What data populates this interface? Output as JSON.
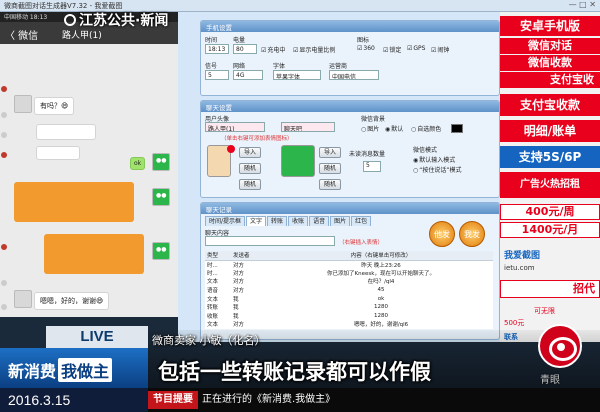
{
  "window": {
    "title": "微商截图对话生成器V7.32 - 我爱截图",
    "controls": "— □ ✕"
  },
  "phone": {
    "status": "中国移动  18:13",
    "back": "〈 微信",
    "contact": "路人甲(1)",
    "messages": [
      {
        "side": "left",
        "text": "有吗？😄"
      },
      {
        "side": "right",
        "text": "ok"
      },
      {
        "side": "left",
        "text": "嗯嗯，好的，谢谢😄"
      }
    ]
  },
  "settings_panel": {
    "title": "手机设置",
    "time_label": "时间",
    "time_value": "18:13",
    "battery_label": "电量",
    "battery_value": "80",
    "charging_label": "充电中",
    "show_percent_label": "显示电量比例",
    "icon_label": "图标",
    "icon_options": [
      {
        "label": "360",
        "on": true
      },
      {
        "label": "锁定",
        "on": true
      },
      {
        "label": "GPS",
        "on": true
      },
      {
        "label": "闹钟",
        "on": true
      }
    ],
    "signal_label": "信号",
    "signal_value": "5",
    "network_label": "网络",
    "network_value": "4G",
    "font_label": "字体",
    "font_value": "苹果字体",
    "carrier_label": "运营商",
    "carrier_value": "中国电信"
  },
  "chat_panel": {
    "title": "聊天设置",
    "user_avatar_label": "用户头像",
    "nickname_a": "路人甲(1)",
    "nickname_b": "聊天吧",
    "avatar_hint": "（单击右键可添加表情图标）",
    "import_label": "导入",
    "random_label": "随机",
    "bg_label": "微信背景",
    "bg_options": [
      {
        "label": "图片",
        "on": false
      },
      {
        "label": "默认",
        "on": true
      },
      {
        "label": "自选颜色",
        "on": false
      }
    ],
    "unread_label": "未读消息数量",
    "unread_value": "5",
    "mode_label": "微信模式",
    "mode_options": [
      {
        "label": "默认输入模式",
        "on": true
      },
      {
        "label": "“按住说话”模式",
        "on": false
      }
    ]
  },
  "message_panel": {
    "title": "聊天记录",
    "tabs": [
      "时间/提示框",
      "文字",
      "转账",
      "收账",
      "语音",
      "图片",
      "红包"
    ],
    "active_tab": 1,
    "chat_with_label": "聊天内容",
    "hint": "（右键插入表情）",
    "send_label": "他发",
    "send_label_b": "我发",
    "columns": [
      "类型",
      "发送者",
      "内容（右键单击可修改）"
    ],
    "rows": [
      [
        "时...",
        "对方",
        "昨天 晚上23:26"
      ],
      [
        "时...",
        "对方",
        "你已添加了Kneesk，现在可以开始聊天了。"
      ],
      [
        "文本",
        "对方",
        "在吗？/ql4"
      ],
      [
        "语音",
        "对方",
        "45"
      ],
      [
        "文本",
        "我",
        "ok"
      ],
      [
        "转账",
        "我",
        "1280"
      ],
      [
        "收账",
        "我",
        "1280"
      ],
      [
        "文本",
        "对方",
        "嗯嗯，好的，谢谢/ql6"
      ]
    ]
  },
  "ads": {
    "a1": "安卓手机版",
    "a2": "微信对话",
    "a3": "微信收款",
    "a4": "支付宝收",
    "a5": "支付宝收款",
    "a6": "明细/账单",
    "a7": "支持5S/6P",
    "a8": "广告火热招租",
    "a9": "400元/周",
    "a10": "1400元/月",
    "a11": "我爱截图",
    "a12": "ietu.com",
    "a13": "招代",
    "a14": "500元",
    "a15": "可无限",
    "a16": "联系"
  },
  "broadcast": {
    "station": "江苏公共·新闻",
    "live": "LIVE",
    "program_a": "新消费",
    "program_b": "我做主",
    "speaker": "微商卖家 小敏（化名）",
    "subtitle": "包括一些转账记录都可以作假",
    "date": "2016.3.15",
    "ticker_tag": "节目提要",
    "ticker_text": "正在进行的《新消费.我做主》",
    "watermark": "青眼"
  },
  "colors": {
    "accent_red": "#c4151b",
    "program_blue": "#1d6fc4",
    "wechat_green": "#2bb54a",
    "bubble_orange": "#f29a2e"
  }
}
